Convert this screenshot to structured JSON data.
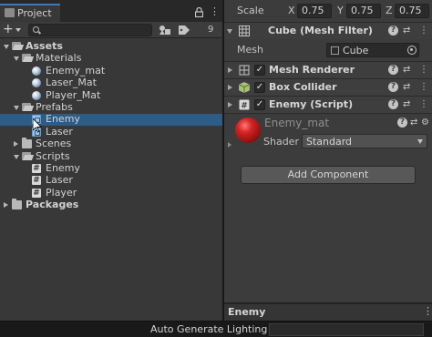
{
  "project_panel": {
    "tab_label": "Project",
    "menu_glyph": "⋮",
    "search": {
      "value": "",
      "placeholder": ""
    },
    "hidden_count": "9",
    "tree": [
      {
        "label": "Assets",
        "icon": "folder-open-icon",
        "expanded": true,
        "bold": true
      },
      {
        "label": "Materials",
        "icon": "folder-open-icon",
        "expanded": true
      },
      {
        "label": "Enemy_mat",
        "icon": "material-icon"
      },
      {
        "label": "Laser_Mat",
        "icon": "material-icon"
      },
      {
        "label": "Player_Mat",
        "icon": "material-icon"
      },
      {
        "label": "Prefabs",
        "icon": "folder-open-icon",
        "expanded": true
      },
      {
        "label": "Enemy",
        "icon": "prefab-icon",
        "selected": true
      },
      {
        "label": "Laser",
        "icon": "prefab-icon"
      },
      {
        "label": "Scenes",
        "icon": "folder-icon",
        "expanded": false
      },
      {
        "label": "Scripts",
        "icon": "folder-open-icon",
        "expanded": true
      },
      {
        "label": "Enemy",
        "icon": "script-icon"
      },
      {
        "label": "Laser",
        "icon": "script-icon"
      },
      {
        "label": "Player",
        "icon": "script-icon"
      },
      {
        "label": "Packages",
        "icon": "folder-icon",
        "expanded": false,
        "bold": true
      }
    ]
  },
  "inspector": {
    "scale": {
      "label": "Scale",
      "x_label": "X",
      "x": "0.75",
      "y_label": "Y",
      "y": "0.75",
      "z_label": "Z",
      "z": "0.75"
    },
    "mesh_filter": {
      "title": "Cube (Mesh Filter)",
      "mesh_label": "Mesh",
      "mesh_value": "Cube"
    },
    "components": [
      {
        "title": "Mesh Renderer",
        "icon": "mesh-renderer-icon",
        "enabled": true
      },
      {
        "title": "Box Collider",
        "icon": "box-collider-icon",
        "enabled": true
      },
      {
        "title": "Enemy (Script)",
        "icon": "script-icon",
        "enabled": true
      }
    ],
    "material": {
      "name": "Enemy_mat",
      "shader_label": "Shader",
      "shader_value": "Standard"
    },
    "add_component_label": "Add Component",
    "preview_title": "Enemy",
    "menu_glyph": "⋮",
    "check_glyph": "✓",
    "help_glyph": "?",
    "script_glyph": "#"
  },
  "status_bar": {
    "text": "Auto Generate Lighting Off"
  },
  "colors": {
    "accent": "#3a79bb",
    "selection": "#2c5d87",
    "material_red": "#d42424"
  }
}
